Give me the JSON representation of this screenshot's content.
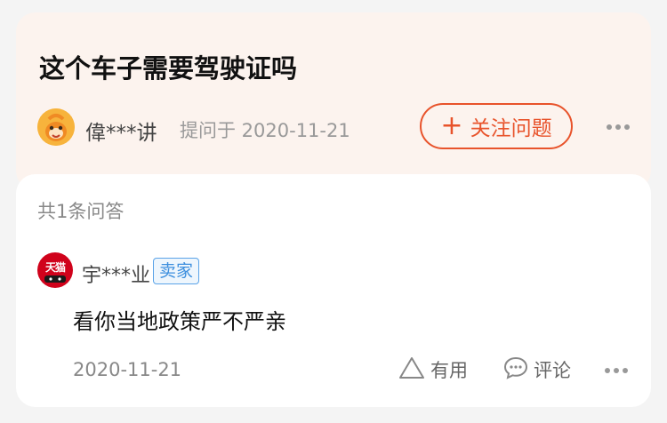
{
  "question": {
    "title": "这个车子需要驾驶证吗",
    "asker_name": "偉***讲",
    "asked_on": "提问于 2020-11-21",
    "follow_button": {
      "icon": "plus-icon",
      "label": "关注问题"
    },
    "more_icon": "more-dots-icon"
  },
  "answers": {
    "count_label": "共1条问答",
    "items": [
      {
        "avatar_text": "天猫",
        "name": "宇***业",
        "badge": "卖家",
        "text": "看你当地政策严不严亲",
        "date": "2020-11-21",
        "useful_label": "有用",
        "comment_label": "评论"
      }
    ]
  },
  "colors": {
    "accent": "#e8532b",
    "question_bg": "#fcf3ee",
    "badge_blue": "#3d8fde"
  }
}
